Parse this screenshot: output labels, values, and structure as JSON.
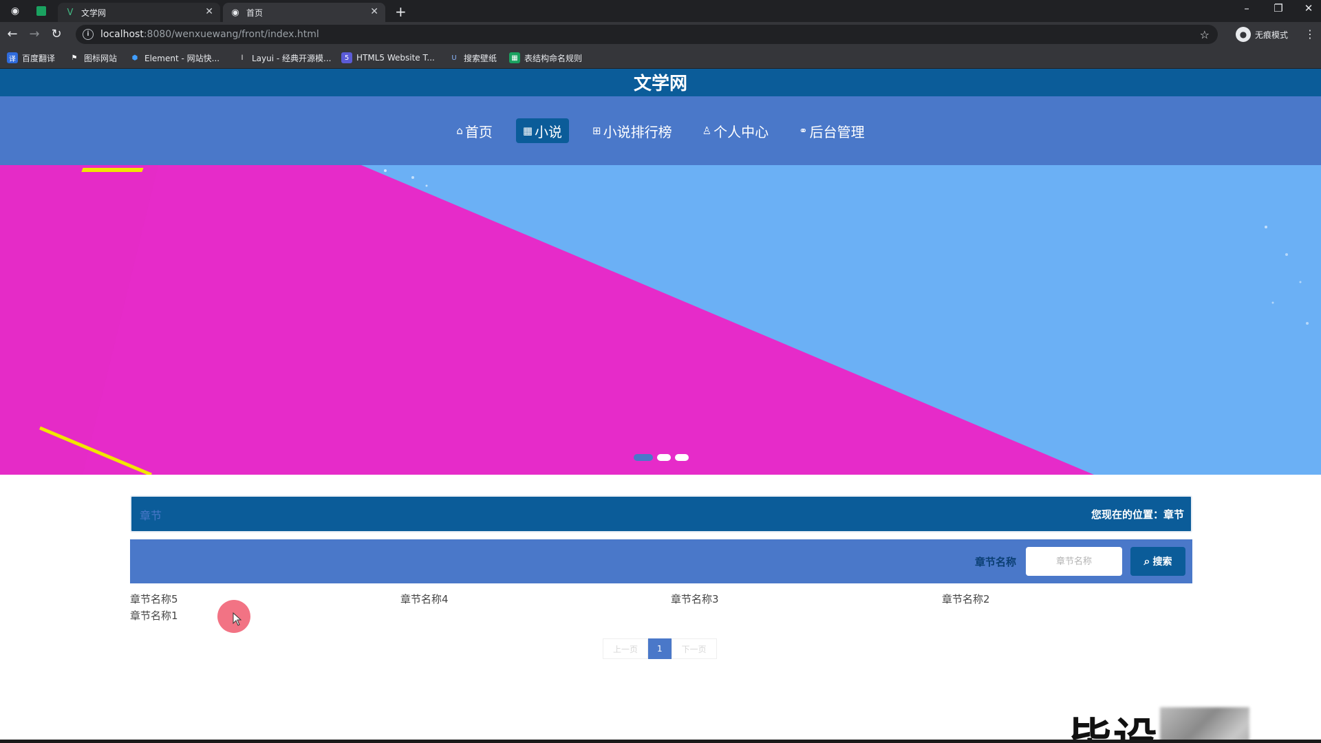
{
  "browser": {
    "tabs": [
      {
        "title": "文学网",
        "icon": "vue-icon",
        "active": false
      },
      {
        "title": "首页",
        "icon": "globe-icon",
        "active": true
      }
    ],
    "address": {
      "host": "localhost",
      "path": ":8080/wenxuewang/front/index.html"
    },
    "profile_label": "无痕模式",
    "bookmarks": [
      {
        "label": "百度翻译",
        "color": "#2f6bdb"
      },
      {
        "label": "图标网站",
        "color": "#35363a"
      },
      {
        "label": "Element - 网站快...",
        "color": "#409eff"
      },
      {
        "label": "Layui - 经典开源模...",
        "color": "#35363a"
      },
      {
        "label": "HTML5 Website T...",
        "color": "#5b5bd6"
      },
      {
        "label": "搜索壁纸",
        "color": "#35363a"
      },
      {
        "label": "表结构命名规则",
        "color": "#1aa260"
      }
    ]
  },
  "site": {
    "title": "文学网",
    "nav": [
      {
        "label": "首页",
        "icon": "home-icon",
        "active": false
      },
      {
        "label": "小说",
        "icon": "grid-icon",
        "active": true
      },
      {
        "label": "小说排行榜",
        "icon": "table-icon",
        "active": false
      },
      {
        "label": "个人中心",
        "icon": "user-icon",
        "active": false
      },
      {
        "label": "后台管理",
        "icon": "link-icon",
        "active": false
      }
    ],
    "carousel": {
      "slide_count": 3,
      "active_index": 0
    }
  },
  "section": {
    "title": "章节",
    "breadcrumb": "您现在的位置：章节"
  },
  "search": {
    "label": "章节名称",
    "placeholder": "章节名称",
    "button_label": "搜索"
  },
  "chapters": [
    "章节名称5",
    "章节名称4",
    "章节名称3",
    "章节名称2",
    "章节名称1"
  ],
  "pagination": {
    "prev": "上一页",
    "current": "1",
    "next": "下一页"
  },
  "watermark": {
    "text": "毕设"
  },
  "colors": {
    "header": "#0b5c99",
    "nav": "#4a78c9",
    "banner_magenta": "#e62bc9",
    "banner_blue": "#6bb0f5"
  }
}
